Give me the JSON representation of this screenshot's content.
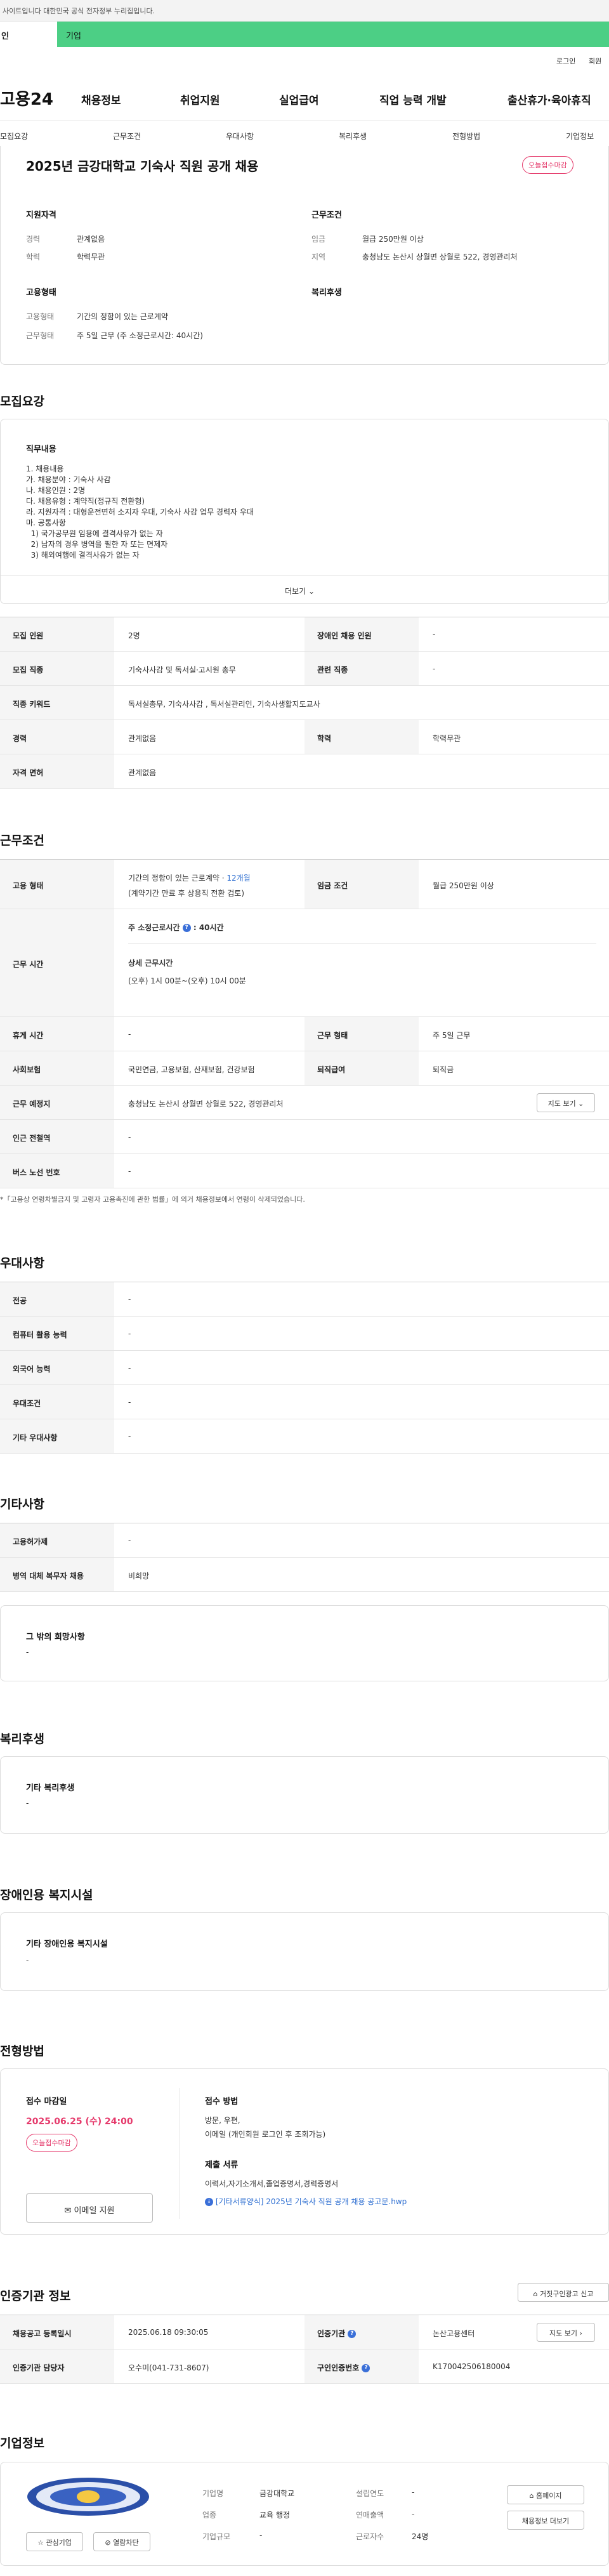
{
  "topbar": {
    "notice": "사이트입니다 대한민국 공식 전자정부 누리집입니다."
  },
  "tabs": [
    "인",
    "기업"
  ],
  "util": {
    "login": "로그인",
    "join": "회원"
  },
  "logo": "고용24",
  "gnb": [
    "채용정보",
    "취업지원",
    "실업급여",
    "직업 능력 개발",
    "출산휴가·육아휴직"
  ],
  "subnav": [
    "모집요강",
    "근무조건",
    "우대사항",
    "복리후생",
    "전형방법",
    "기업정보"
  ],
  "summary": {
    "title": "2025년 금강대학교 기숙사 직원 공개 채용",
    "badge": "오늘접수마감",
    "qual_title": "지원자격",
    "cond_title": "근무조건",
    "type_title": "고용형태",
    "welfare_title": "복리후생",
    "qual": [
      {
        "k": "경력",
        "v": "관계없음"
      },
      {
        "k": "학력",
        "v": "학력무관"
      }
    ],
    "cond": [
      {
        "k": "임금",
        "v": "월급 250만원 이상"
      },
      {
        "k": "지역",
        "v": "충청남도 논산시 상월면 상월로 522, 경영관리처"
      }
    ],
    "type": [
      {
        "k": "고용형태",
        "v": "기간의 정함이 있는 근로계약"
      },
      {
        "k": "근무형태",
        "v": "주 5일 근무 (주 소정근로시간: 40시간)"
      }
    ]
  },
  "recruit": {
    "section": "모집요강",
    "duty_title": "직무내용",
    "duty_text": "1. 채용내용\n가. 채용분야 : 기숙사 사감\n나. 채용인원 : 2명\n다. 채용유형 : 계약직(정규직 전환형)\n라. 지원자격 : 대형운전면허 소지자 우대, 기숙사 사감 업무 경력자 우대\n마. 공통사항\n  1) 국가공무원 임용에 결격사유가 없는 자\n  2) 남자의 경우 병역을 필한 자 또는 면제자\n  3) 해외여행에 결격사유가 없는 자",
    "more": "더보기",
    "rows": [
      {
        "k1": "모집 인원",
        "v1": "2명",
        "k2": "장애인 채용 인원",
        "v2": "-"
      },
      {
        "k1": "모집 직종",
        "v1": "기숙사사감 및 독서실·고시원 총무",
        "k2": "관련 직종",
        "v2": "-"
      },
      {
        "k1": "직종 키워드",
        "v1": "독서실총무, 기숙사사감 , 독서실관리인, 기숙사생활지도교사"
      },
      {
        "k1": "경력",
        "v1": "관계없음",
        "k2": "학력",
        "v2": "학력무관"
      },
      {
        "k1": "자격 면허",
        "v1": "관계없음"
      }
    ]
  },
  "work": {
    "section": "근무조건",
    "emp_k": "고용 형태",
    "emp_v": "기간의 정함이 있는 근로계약 · ",
    "emp_months": "12개월",
    "emp_sub": "(계약기간 만료 후 상용직 전환 검토)",
    "wage_k": "임금 조건",
    "wage_v": "월급 250만원 이상",
    "hours_k": "근무 시간",
    "hours_a": "주 소정근로시간",
    "hours_b": ": 40시간",
    "hours_detail_title": "상세 근무시간",
    "hours_detail": "(오후) 1시 00분~(오후) 10시 00분",
    "rows": [
      {
        "k1": "휴게 시간",
        "v1": "-",
        "k2": "근무 형태",
        "v2": "주 5일 근무"
      },
      {
        "k1": "사회보험",
        "v1": "국민연금, 고용보험, 산재보험, 건강보험",
        "k2": "퇴직급여",
        "v2": "퇴직금"
      },
      {
        "k1": "근무 예정지",
        "v1": "충청남도 논산시 상월면 상월로 522, 경영관리처"
      },
      {
        "k1": "인근 전철역",
        "v1": "-"
      },
      {
        "k1": "버스 노선 번호",
        "v1": "-"
      }
    ],
    "map_btn": "지도 보기",
    "note": "*「고용상 연령차별금지 및 고령자 고용촉진에 관한 법률」에 의거 채용정보에서 연령이 삭제되었습니다."
  },
  "pref": {
    "section": "우대사항",
    "rows": [
      {
        "k": "전공",
        "v": "-"
      },
      {
        "k": "컴퓨터 활용 능력",
        "v": "-"
      },
      {
        "k": "외국어 능력",
        "v": "-"
      },
      {
        "k": "우대조건",
        "v": "-"
      },
      {
        "k": "기타 우대사항",
        "v": "-"
      }
    ]
  },
  "etc": {
    "section": "기타사항",
    "rows": [
      {
        "k": "고용허가제",
        "v": "-"
      },
      {
        "k": "병역 대체 복무자 채용",
        "v": "비희망"
      }
    ],
    "box_title": "그 밖의 희망사항",
    "box_value": "-"
  },
  "welfare": {
    "section": "복리후생",
    "box_title": "기타 복리후생",
    "box_value": "-"
  },
  "disabled": {
    "section": "장애인용 복지시설",
    "box_title": "기타 장애인용 복지시설",
    "box_value": "-"
  },
  "apply": {
    "section": "전형방법",
    "deadline_title": "접수 마감일",
    "deadline": "2025.06.25 (수) 24:00",
    "badge": "오늘접수마감",
    "email_btn": "이메일 지원",
    "method_title": "접수 방법",
    "methods": [
      "방문, 우편,",
      "이메일 (개인회원 로그인 후 조회가능)"
    ],
    "docs_title": "제출 서류",
    "docs": "이력서,자기소개서,졸업증명서,경력증명서",
    "file": "[기타서류양식] 2025년 기숙사 직원 공개 채용 공고문.hwp"
  },
  "cert": {
    "section": "인증기관 정보",
    "report_btn": "거짓구인광고 신고",
    "r1": {
      "k1": "채용공고 등록일시",
      "v1": "2025.06.18 09:30:05",
      "k2": "인증기관",
      "v2": "논산고용센터",
      "btn": "지도 보기"
    },
    "r2": {
      "k1": "인증기관 담당자",
      "v1": "오수미(041-731-8607)",
      "k2": "구인인증번호",
      "v2": "K170042506180004"
    }
  },
  "company": {
    "section": "기업정보",
    "fields": [
      {
        "k": "기업명",
        "v": "금강대학교"
      },
      {
        "k": "업종",
        "v": "교육 행정"
      },
      {
        "k": "기업규모",
        "v": "-"
      }
    ],
    "fields2": [
      {
        "k": "설립연도",
        "v": "-"
      },
      {
        "k": "연매출액",
        "v": "-"
      },
      {
        "k": "근로자수",
        "v": "24명"
      }
    ],
    "btn_home": "홈페이지",
    "btn_more": "채용정보 더보기",
    "btn_fav": "관심기업",
    "btn_block": "열람차단"
  }
}
